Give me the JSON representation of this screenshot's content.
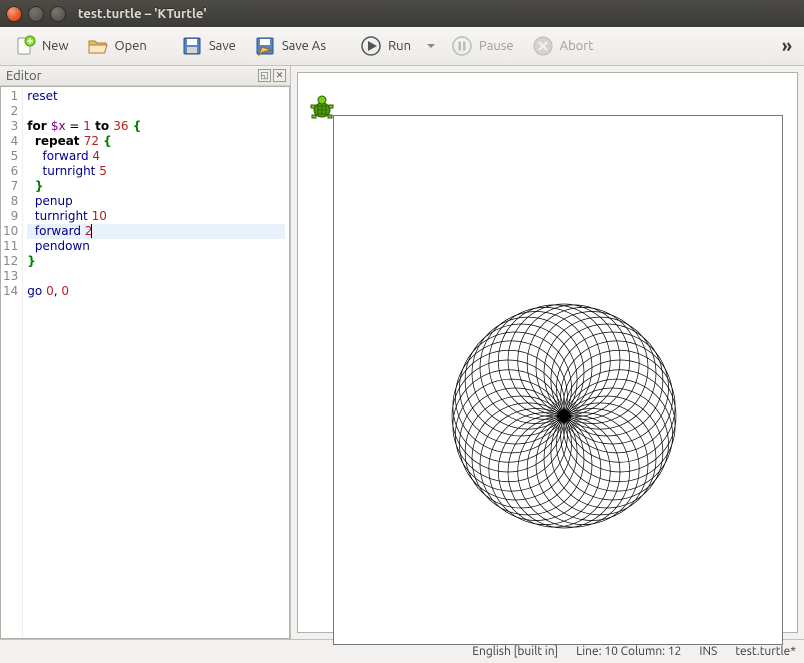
{
  "window": {
    "title": "test.turtle – 'KTurtle'"
  },
  "toolbar": {
    "new": "New",
    "open": "Open",
    "save": "Save",
    "saveas": "Save As",
    "run": "Run",
    "pause": "Pause",
    "abort": "Abort",
    "overflow": "»"
  },
  "editor": {
    "title": "Editor",
    "lines": [
      [
        {
          "t": "reset",
          "cls": "tok-cmd"
        }
      ],
      [],
      [
        {
          "t": "for ",
          "cls": "tok-kw"
        },
        {
          "t": "$x",
          "cls": "tok-var"
        },
        {
          "t": " = "
        },
        {
          "t": "1",
          "cls": "tok-num"
        },
        {
          "t": " to ",
          "cls": "tok-kw"
        },
        {
          "t": "36",
          "cls": "tok-num"
        },
        {
          "t": " {",
          "cls": "tok-op"
        }
      ],
      [
        {
          "t": "  "
        },
        {
          "t": "repeat ",
          "cls": "tok-kw"
        },
        {
          "t": "72",
          "cls": "tok-num"
        },
        {
          "t": " {",
          "cls": "tok-op"
        }
      ],
      [
        {
          "t": "    "
        },
        {
          "t": "forward ",
          "cls": "tok-cmd"
        },
        {
          "t": "4",
          "cls": "tok-num"
        }
      ],
      [
        {
          "t": "    "
        },
        {
          "t": "turnright ",
          "cls": "tok-cmd"
        },
        {
          "t": "5",
          "cls": "tok-num"
        }
      ],
      [
        {
          "t": "  "
        },
        {
          "t": "}",
          "cls": "tok-op"
        }
      ],
      [
        {
          "t": "  "
        },
        {
          "t": "penup",
          "cls": "tok-cmd"
        }
      ],
      [
        {
          "t": "  "
        },
        {
          "t": "turnright ",
          "cls": "tok-cmd"
        },
        {
          "t": "10",
          "cls": "tok-num"
        }
      ],
      [
        {
          "t": "  "
        },
        {
          "t": "forward ",
          "cls": "tok-cmd"
        },
        {
          "t": "2",
          "cls": "tok-num"
        }
      ],
      [
        {
          "t": "  "
        },
        {
          "t": "pendown",
          "cls": "tok-cmd"
        }
      ],
      [
        {
          "t": "}",
          "cls": "tok-op"
        }
      ],
      [],
      [
        {
          "t": "go ",
          "cls": "tok-cmd"
        },
        {
          "t": "0",
          "cls": "tok-num"
        },
        {
          "t": ", "
        },
        {
          "t": "0",
          "cls": "tok-num"
        }
      ]
    ],
    "highlight_line": 10
  },
  "status": {
    "lang": "English [built in]",
    "pos": "Line: 10 Column: 12",
    "mode": "INS",
    "file": "test.turtle*"
  }
}
